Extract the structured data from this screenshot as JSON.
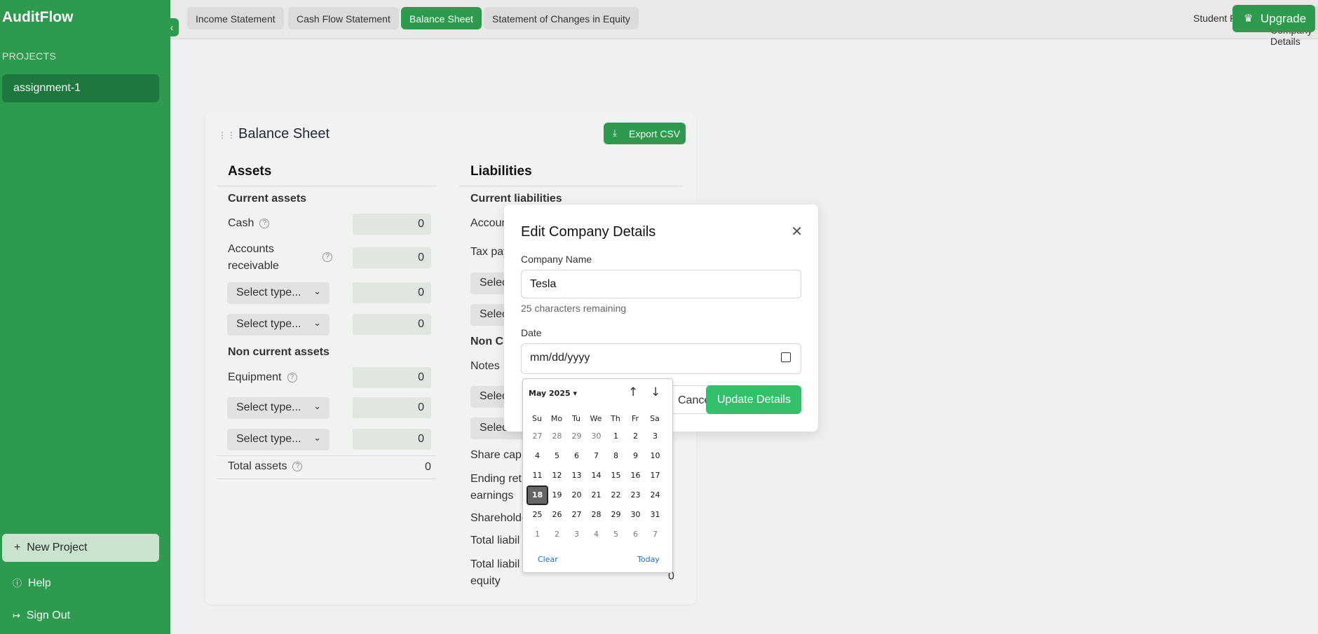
{
  "app": {
    "name": "AuditFlow"
  },
  "sidebar": {
    "collapse_icon": "‹",
    "projects_label": "PROJECTS",
    "projects": [
      {
        "label": "assignment-1"
      }
    ],
    "new_project_label": "New Project",
    "help_label": "Help",
    "sign_out_label": "Sign Out"
  },
  "topbar": {
    "tabs": [
      {
        "label": "Income Statement"
      },
      {
        "label": "Cash Flow Statement"
      },
      {
        "label": "Balance Sheet"
      },
      {
        "label": "Statement of Changes in Equity"
      }
    ],
    "active_tab": "Balance Sheet",
    "plan_label": "Student Plan",
    "edit_company_label": "Edit Company Details",
    "upgrade_label": "Upgrade"
  },
  "card": {
    "title": "Balance Sheet",
    "export_label": "Export CSV",
    "assets": {
      "heading": "Assets",
      "current_label": "Current assets",
      "cash_label": "Cash",
      "cash_value": "0",
      "ar_label_1": "Accounts",
      "ar_label_2": "receivable",
      "ar_value": "0",
      "select_1": "Select type...",
      "select_1_value": "0",
      "select_2": "Select type...",
      "select_2_value": "0",
      "noncurrent_label": "Non current assets",
      "equipment_label": "Equipment",
      "equipment_value": "0",
      "select_3": "Select type...",
      "select_3_value": "0",
      "select_4": "Select type...",
      "select_4_value": "0",
      "total_label": "Total assets",
      "total_value": "0"
    },
    "liabilities": {
      "heading": "Liabilities",
      "current_label": "Current liabilities",
      "accounts_label": "Accoun",
      "tax_label": "Tax pay",
      "select_1": "Selec",
      "select_2": "Selec",
      "noncurrent_label": "Non Cu",
      "notes_label": "Notes",
      "select_3": "Selec",
      "select_4": "Selec",
      "share_cap_label": "Share capi",
      "ending_label_1": "Ending ret",
      "ending_label_2": "earnings",
      "shareholders_label": "Shareholde",
      "total_liab_label": "Total liabil",
      "total_liab_eq_label_1": "Total liabil",
      "total_liab_eq_label_2": "equity",
      "total_liab_eq_value": "0"
    }
  },
  "modal": {
    "title": "Edit Company Details",
    "company_name_label": "Company Name",
    "company_name_value": "Tesla",
    "chars_remaining": "25 characters remaining",
    "date_label": "Date",
    "date_placeholder": "mm/dd/yyyy",
    "cancel_label": "Cancel",
    "update_label": "Update Details"
  },
  "datepicker": {
    "month_label": "May 2025 ▾",
    "prev_icon": "↑",
    "next_icon": "↓",
    "weekdays": [
      "Su",
      "Mo",
      "Tu",
      "We",
      "Th",
      "Fr",
      "Sa"
    ],
    "weeks": [
      [
        "27",
        "28",
        "29",
        "30",
        "1",
        "2",
        "3"
      ],
      [
        "4",
        "5",
        "6",
        "7",
        "8",
        "9",
        "10"
      ],
      [
        "11",
        "12",
        "13",
        "14",
        "15",
        "16",
        "17"
      ],
      [
        "18",
        "19",
        "20",
        "21",
        "22",
        "23",
        "24"
      ],
      [
        "25",
        "26",
        "27",
        "28",
        "29",
        "30",
        "31"
      ],
      [
        "1",
        "2",
        "3",
        "4",
        "5",
        "6",
        "7"
      ]
    ],
    "selected_day": "18",
    "clear_label": "Clear",
    "today_label": "Today"
  },
  "colors": {
    "brand_green": "#2e9e50",
    "update_button": "#34c06a"
  }
}
